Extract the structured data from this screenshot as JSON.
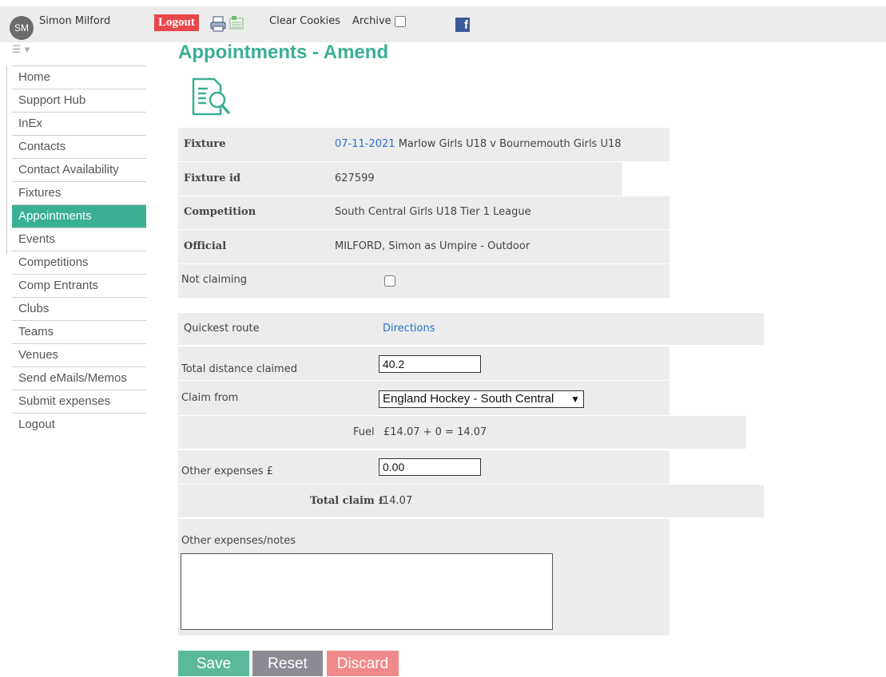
{
  "user": {
    "initials": "SM",
    "name": "Simon Milford"
  },
  "topbar": {
    "logout_label": "Logout",
    "clear_cookies_label": "Clear Cookies",
    "archive_label": "Archive"
  },
  "sidebar": {
    "items": [
      {
        "label": "Home"
      },
      {
        "label": "Support Hub"
      },
      {
        "label": "InEx"
      },
      {
        "label": "Contacts"
      },
      {
        "label": "Contact Availability"
      },
      {
        "label": "Fixtures"
      },
      {
        "label": "Appointments",
        "active": true
      },
      {
        "label": "Events"
      },
      {
        "label": "Competitions"
      },
      {
        "label": "Comp Entrants"
      },
      {
        "label": "Clubs"
      },
      {
        "label": "Teams"
      },
      {
        "label": "Venues"
      },
      {
        "label": "Send eMails/Memos"
      },
      {
        "label": "Submit expenses"
      },
      {
        "label": "Logout"
      }
    ]
  },
  "page": {
    "title": "Appointments - Amend"
  },
  "details": {
    "fixture_label": "Fixture",
    "fixture_date": "07-11-2021",
    "fixture_desc": "Marlow Girls U18 v Bournemouth Girls U18",
    "fixture_id_label": "Fixture id",
    "fixture_id": "627599",
    "competition_label": "Competition",
    "competition": "South Central Girls U18 Tier 1 League",
    "official_label": "Official",
    "official": "MILFORD, Simon as Umpire - Outdoor",
    "not_claiming_label": "Not claiming"
  },
  "expenses": {
    "route_label": "Quickest route",
    "route_link": "Directions",
    "distance_label": "Total distance claimed",
    "distance_value": "40.2",
    "claim_from_label": "Claim from",
    "claim_from_value": "England Hockey - South Central",
    "fuel_label": "Fuel",
    "fuel_calc": "£14.07 + 0 = 14.07",
    "other_label": "Other expenses £",
    "other_value": "0.00",
    "total_label": "Total claim £",
    "total_value": "14.07",
    "notes_label": "Other expenses/notes"
  },
  "actions": {
    "save": "Save",
    "reset": "Reset",
    "discard": "Discard"
  },
  "colors": {
    "accent": "#3aaf94",
    "logout": "#e8474c",
    "reset": "#8e8a94",
    "discard": "#f08a8a",
    "link": "#2a6fc9"
  }
}
